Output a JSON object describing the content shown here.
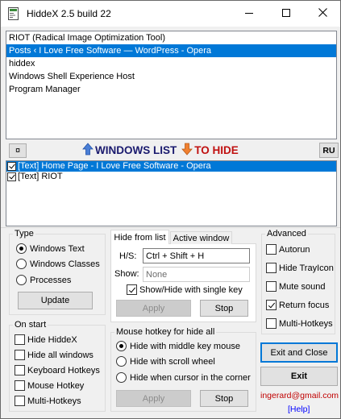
{
  "window": {
    "title": "HiddeX 2.5 build 22"
  },
  "top_list": {
    "items": [
      {
        "label": "RIOT (Radical Image Optimization Tool)",
        "selected": false
      },
      {
        "label": "Posts ‹ I Love Free Software — WordPress - Opera",
        "selected": true
      },
      {
        "label": "hiddex",
        "selected": false
      },
      {
        "label": "Windows Shell Experience Host",
        "selected": false
      },
      {
        "label": "Program Manager",
        "selected": false
      }
    ]
  },
  "middle_bar": {
    "pin_symbol": "¤",
    "windows_list_label": "WINDOWS LIST",
    "to_hide_label": "TO HIDE",
    "language_button": "RU",
    "up_arrow_color": "#4a7fd6",
    "down_arrow_color": "#f08030"
  },
  "hide_list": {
    "items": [
      {
        "label": "[Text] Home Page - I Love Free Software - Opera",
        "checked": true,
        "selected": true
      },
      {
        "label": "[Text] RIOT",
        "checked": true,
        "selected": false
      }
    ]
  },
  "type_group": {
    "title": "Type",
    "options": [
      {
        "label": "Windows Text",
        "checked": true
      },
      {
        "label": "Windows Classes",
        "checked": false
      },
      {
        "label": "Processes",
        "checked": false
      }
    ],
    "update_button": "Update"
  },
  "on_start_group": {
    "title": "On start",
    "options": [
      {
        "label": "Hide HiddeX",
        "checked": false
      },
      {
        "label": "Hide all windows",
        "checked": false
      },
      {
        "label": "Keyboard Hotkeys",
        "checked": false
      },
      {
        "label": "Mouse Hotkey",
        "checked": false
      },
      {
        "label": "Multi-Hotkeys",
        "checked": false
      }
    ]
  },
  "hide_from_list": {
    "tabs": [
      {
        "label": "Hide from list",
        "active": true
      },
      {
        "label": "Active window",
        "active": false
      }
    ],
    "hs_label": "H/S:",
    "hs_value": "Ctrl + Shift + H",
    "show_label": "Show:",
    "show_value": "None",
    "single_key_label": "Show/Hide with single key",
    "single_key_checked": true,
    "apply_button": "Apply",
    "stop_button": "Stop"
  },
  "mouse_hotkey": {
    "title": "Mouse hotkey for hide all",
    "options": [
      {
        "label": "Hide with middle key mouse",
        "checked": true
      },
      {
        "label": "Hide with scroll wheel",
        "checked": false
      },
      {
        "label": "Hide when cursor in the corner",
        "checked": false
      }
    ],
    "apply_button": "Apply",
    "stop_button": "Stop"
  },
  "advanced_group": {
    "title": "Advanced",
    "options": [
      {
        "label": "Autorun",
        "checked": false
      },
      {
        "label": "Hide TrayIcon",
        "checked": false
      },
      {
        "label": "Mute sound",
        "checked": false
      },
      {
        "label": "Return focus",
        "checked": true
      },
      {
        "label": "Multi-Hotkeys",
        "checked": false
      }
    ]
  },
  "actions": {
    "exit_close_button": "Exit and Close",
    "exit_button": "Exit",
    "email": "ingerard@gmail.com",
    "help_link": "[Help]",
    "accent_color": "#0078d7"
  }
}
